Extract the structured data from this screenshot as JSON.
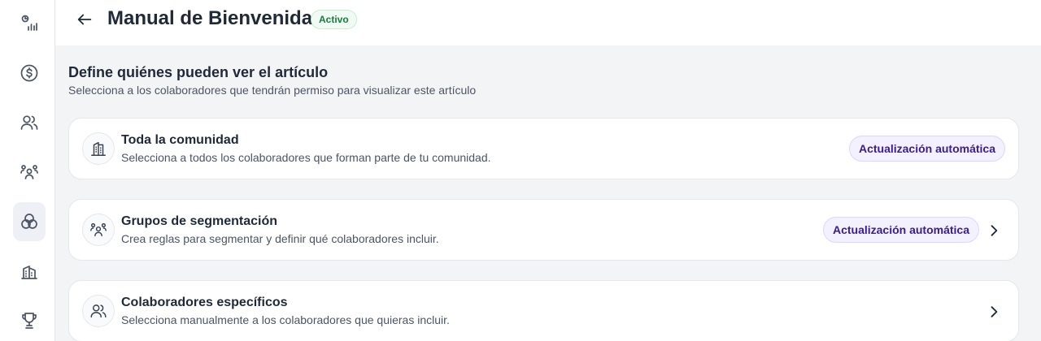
{
  "sidebar": {
    "items": [
      {
        "icon": "analytics-icon"
      },
      {
        "icon": "dollar-icon"
      },
      {
        "icon": "users-icon"
      },
      {
        "icon": "team-icon"
      },
      {
        "icon": "circles-icon",
        "active": true
      },
      {
        "icon": "building-icon"
      },
      {
        "icon": "trophy-icon"
      }
    ]
  },
  "header": {
    "title": "Manual de Bienvenida",
    "status": "Activo",
    "status_color": "#15803d"
  },
  "section": {
    "title": "Define quiénes pueden ver el artículo",
    "subtitle": "Selecciona a los colaboradores que tendrán permiso para visualizar este artículo"
  },
  "options": [
    {
      "icon": "building-icon",
      "title": "Toda la comunidad",
      "description": "Selecciona a todos los colaboradores que forman parte de tu comunidad.",
      "badge": "Actualización automática",
      "has_chevron": false
    },
    {
      "icon": "team-icon",
      "title": "Grupos de segmentación",
      "description": "Crea reglas para segmentar y definir qué colaboradores incluir.",
      "badge": "Actualización automática",
      "has_chevron": true
    },
    {
      "icon": "users-icon",
      "title": "Colaboradores específicos",
      "description": "Selecciona manualmente a los colaboradores que quieras incluir.",
      "badge": "",
      "has_chevron": true
    }
  ],
  "colors": {
    "accent_badge_bg": "#f3f0ff",
    "accent_badge_text": "#3b1d8f"
  }
}
